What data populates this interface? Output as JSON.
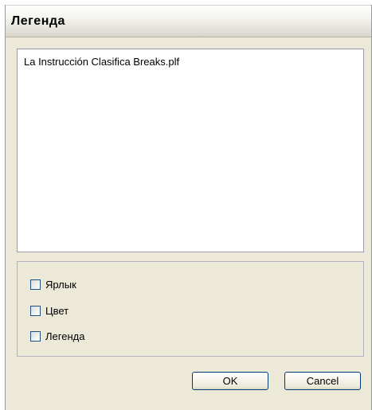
{
  "window": {
    "title": "Легенда"
  },
  "list": {
    "items": [
      "La Instrucción Clasifica Breaks.plf"
    ]
  },
  "options": [
    {
      "label": "Ярлык",
      "checked": false
    },
    {
      "label": "Цвет",
      "checked": false
    },
    {
      "label": "Легенда",
      "checked": false
    }
  ],
  "buttons": {
    "ok": "OK",
    "cancel": "Cancel"
  }
}
